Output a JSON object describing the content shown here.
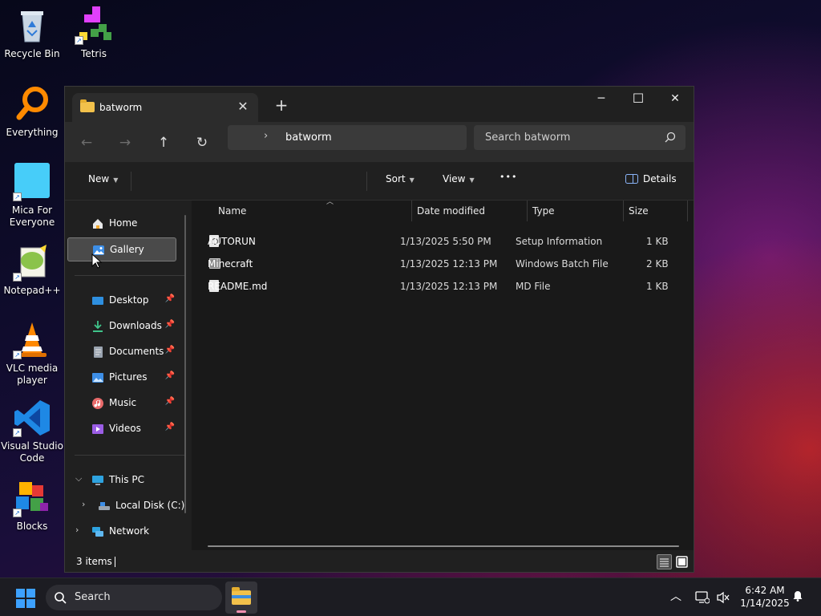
{
  "desktop": {
    "icons": [
      {
        "label": "Recycle Bin",
        "icon": "recycle-bin-icon"
      },
      {
        "label": "Tetris",
        "icon": "tetris-icon"
      },
      {
        "label": "Everything",
        "icon": "everything-search-icon"
      },
      {
        "label": "Mica For Everyone",
        "icon": "mica-icon"
      },
      {
        "label": "Notepad++",
        "icon": "notepadpp-icon"
      },
      {
        "label": "VLC media player",
        "icon": "vlc-cone-icon"
      },
      {
        "label": "Visual Studio Code",
        "icon": "vscode-icon"
      },
      {
        "label": "Blocks",
        "icon": "blocks-icon"
      }
    ]
  },
  "window": {
    "tab_title": "batworm",
    "new_tab_glyph": "+",
    "close_tab_glyph": "✕",
    "controls": {
      "minimize": "─",
      "maximize": "☐",
      "close": "✕"
    },
    "nav": {
      "back": "←",
      "forward": "→",
      "up": "↑",
      "refresh": "↻"
    },
    "address": {
      "chevron": "›",
      "path": "batworm"
    },
    "search": {
      "placeholder": "Search batworm"
    },
    "toolbar": {
      "new": "New",
      "sort": "Sort",
      "view": "View",
      "more": "•••",
      "details": "Details"
    },
    "sidebar": {
      "home": "Home",
      "gallery": "Gallery",
      "quick_access": [
        {
          "label": "Desktop",
          "icon": "desktop-icon"
        },
        {
          "label": "Downloads",
          "icon": "downloads-icon"
        },
        {
          "label": "Documents",
          "icon": "documents-icon"
        },
        {
          "label": "Pictures",
          "icon": "pictures-icon"
        },
        {
          "label": "Music",
          "icon": "music-icon"
        },
        {
          "label": "Videos",
          "icon": "videos-icon"
        }
      ],
      "this_pc": "This PC",
      "local_disk": "Local Disk (C:)",
      "network": "Network"
    },
    "columns": {
      "name": "Name",
      "date": "Date modified",
      "type": "Type",
      "size": "Size"
    },
    "files": [
      {
        "name": "AUTORUN",
        "date": "1/13/2025 5:50 PM",
        "type": "Setup Information",
        "size": "1 KB",
        "icon": "setup-info-file-icon"
      },
      {
        "name": "Minecraft",
        "date": "1/13/2025 12:13 PM",
        "type": "Windows Batch File",
        "size": "2 KB",
        "icon": "batch-file-icon"
      },
      {
        "name": "README.md",
        "date": "1/13/2025 12:13 PM",
        "type": "MD File",
        "size": "1 KB",
        "icon": "document-file-icon"
      }
    ],
    "status": {
      "count": "3 items"
    }
  },
  "taskbar": {
    "search_placeholder": "Search",
    "time": "6:42 AM",
    "date": "1/14/2025",
    "tray_chevron": "︿"
  }
}
